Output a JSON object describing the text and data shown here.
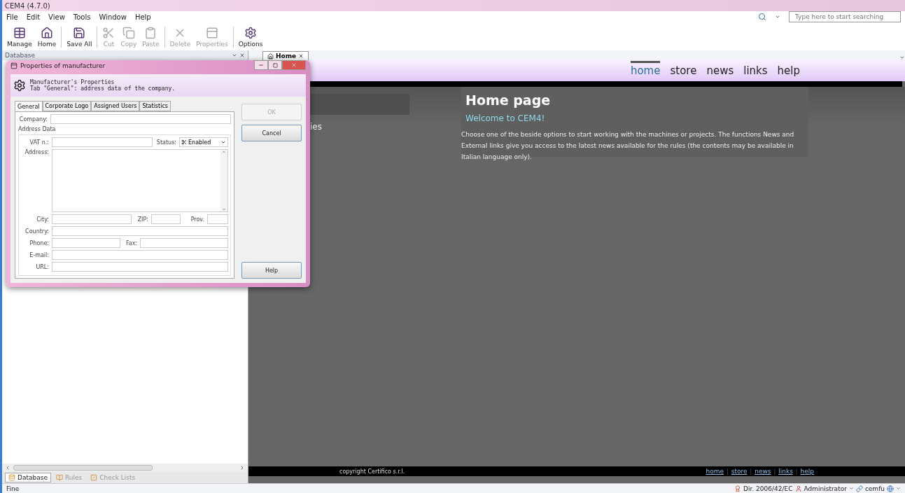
{
  "window": {
    "title": "CEM4 (4.7.0)"
  },
  "menu": [
    "File",
    "Edit",
    "View",
    "Tools",
    "Window",
    "Help"
  ],
  "search": {
    "placeholder": "Type here to start searching"
  },
  "toolbar": [
    {
      "label": "Manage",
      "disabled": false
    },
    {
      "label": "Home",
      "disabled": false
    },
    {
      "label": "Save All",
      "disabled": false
    },
    {
      "label": "Cut",
      "disabled": true
    },
    {
      "label": "Copy",
      "disabled": true
    },
    {
      "label": "Paste",
      "disabled": true
    },
    {
      "label": "Delete",
      "disabled": true
    },
    {
      "label": "Properties",
      "disabled": true
    },
    {
      "label": "Options",
      "disabled": false
    }
  ],
  "dock_panel": {
    "title": "Database",
    "bottom_tabs": [
      {
        "label": "Database",
        "selected": true
      },
      {
        "label": "Rules",
        "selected": false
      },
      {
        "label": "Check Lists",
        "selected": false
      }
    ]
  },
  "doc_tabs": [
    {
      "label": "Home",
      "selected": true
    }
  ],
  "web": {
    "nav": [
      {
        "label": "home",
        "selected": true
      },
      {
        "label": "store",
        "selected": false
      },
      {
        "label": "news",
        "selected": false
      },
      {
        "label": "links",
        "selected": false
      },
      {
        "label": "help",
        "selected": false
      }
    ],
    "sidebar_text": "ies",
    "heading": "Home page",
    "welcome": "Welcome to CEM4!",
    "paragraph": "Choose one of the beside options to start working with the machines or projects. The functions News and External links give you access to the latest news available for the rules (the contents may be available in Italian language only).",
    "copyright": "copyright Certifico s.r.l.",
    "footer_links": [
      "home",
      "store",
      "news",
      "links",
      "help"
    ],
    "footer_separator": "|"
  },
  "dialog": {
    "title": "Properties of manufacturer",
    "header_title": "Manufacturer's Properties",
    "header_subtitle": "Tab \"General\": address data of the company.",
    "tabs": [
      {
        "label": "General",
        "selected": true
      },
      {
        "label": "Corporate Logo",
        "selected": false
      },
      {
        "label": "Assigned Users",
        "selected": false
      },
      {
        "label": "Statistics",
        "selected": false
      }
    ],
    "group": "Address Data",
    "fields": {
      "company": "Company:",
      "vat": "VAT n.:",
      "status": "Status:",
      "address": "Address:",
      "city": "City:",
      "zip": "ZIP:",
      "prov": "Prov.",
      "country": "Country:",
      "phone": "Phone:",
      "fax": "Fax:",
      "email": "E-mail:",
      "url": "URL:"
    },
    "status_value": "Enabled",
    "buttons": [
      {
        "label": "OK",
        "disabled": true
      },
      {
        "label": "Cancel",
        "disabled": false
      },
      {
        "label": "Help",
        "disabled": false
      }
    ]
  },
  "status_bar": {
    "text": "Fine",
    "directive": "Dir. 2006/42/EC",
    "user": "Administrator",
    "connection": "cemfu"
  }
}
